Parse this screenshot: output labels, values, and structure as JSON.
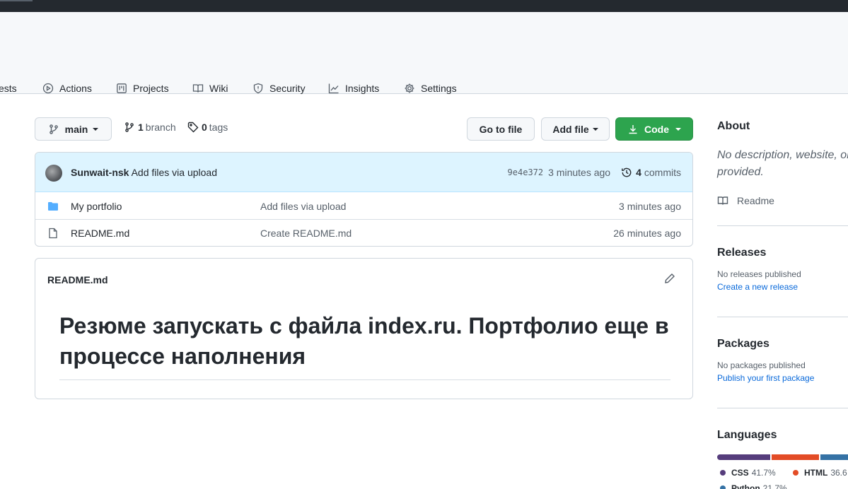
{
  "nav": {
    "items": [
      {
        "label": "ests",
        "icon": "pull-request-icon"
      },
      {
        "label": "Actions",
        "icon": "play-icon"
      },
      {
        "label": "Projects",
        "icon": "project-icon"
      },
      {
        "label": "Wiki",
        "icon": "book-icon"
      },
      {
        "label": "Security",
        "icon": "shield-icon"
      },
      {
        "label": "Insights",
        "icon": "graph-icon"
      },
      {
        "label": "Settings",
        "icon": "gear-icon"
      }
    ]
  },
  "toolbar": {
    "branch_label": "main",
    "branch_count": "1",
    "branch_word": "branch",
    "tag_count": "0",
    "tag_word": "tags",
    "go_to_file": "Go to file",
    "add_file": "Add file",
    "code": "Code"
  },
  "commit": {
    "author": "Sunwait-nsk",
    "message": "Add files via upload",
    "sha": "9e4e372",
    "time": "3 minutes ago",
    "commit_count": "4",
    "commit_word": "commits"
  },
  "files": [
    {
      "name": "My portfolio",
      "type": "folder",
      "message": "Add files via upload",
      "age": "3 minutes ago"
    },
    {
      "name": "README.md",
      "type": "file",
      "message": "Create README.md",
      "age": "26 minutes ago"
    }
  ],
  "readme": {
    "filename": "README.md",
    "heading": "Резюме запускать с файла index.ru. Портфолио еще в процессе наполнения"
  },
  "sidebar": {
    "about_title": "About",
    "about_desc_line1": "No description, website, or",
    "about_desc_line2": "provided.",
    "readme_label": "Readme",
    "releases_title": "Releases",
    "releases_empty": "No releases published",
    "releases_link": "Create a new release",
    "packages_title": "Packages",
    "packages_empty": "No packages published",
    "packages_link": "Publish your first package",
    "languages_title": "Languages",
    "languages": [
      {
        "name": "CSS",
        "percent": "41.7%",
        "value": 41.7,
        "color": "#563d7c"
      },
      {
        "name": "HTML",
        "percent": "36.6",
        "value": 36.6,
        "color": "#e34c26"
      },
      {
        "name": "Python",
        "percent": "21.7%",
        "value": 21.7,
        "color": "#3572A5"
      }
    ]
  },
  "colors": {
    "accent_green": "#2da44e",
    "link_blue": "#0969da",
    "folder_blue": "#54aeff"
  }
}
